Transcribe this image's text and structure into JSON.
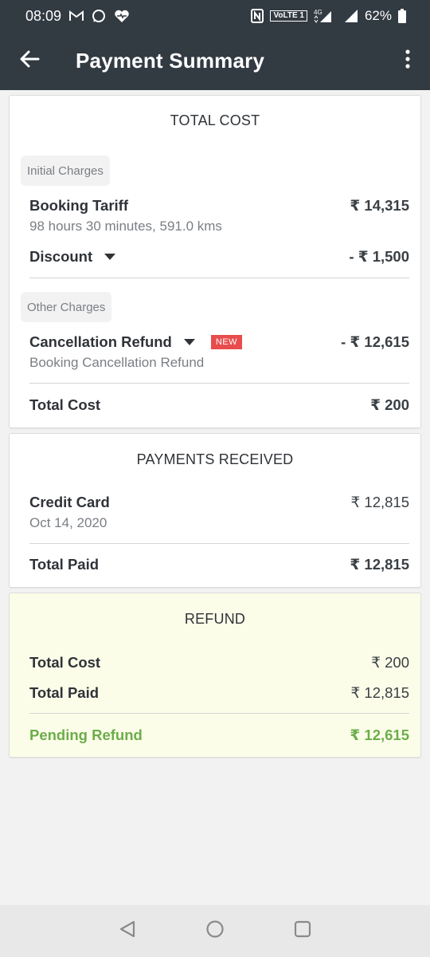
{
  "status_bar": {
    "time": "08:09",
    "network_label": "VoLTE 1",
    "network_type": "4G",
    "battery": "62%"
  },
  "app_bar": {
    "title": "Payment Summary"
  },
  "total_cost_card": {
    "title": "TOTAL COST",
    "initial_charges_label": "Initial Charges",
    "booking_tariff_label": "Booking Tariff",
    "booking_tariff_value": "₹ 14,315",
    "booking_tariff_detail": "98 hours 30 minutes, 591.0 kms",
    "discount_label": "Discount",
    "discount_value": "- ₹ 1,500",
    "other_charges_label": "Other Charges",
    "cancellation_label": "Cancellation Refund",
    "cancellation_badge": "NEW",
    "cancellation_value": "- ₹ 12,615",
    "cancellation_detail": "Booking Cancellation Refund",
    "total_label": "Total Cost",
    "total_value": "₹ 200"
  },
  "payments_card": {
    "title": "PAYMENTS RECEIVED",
    "method_label": "Credit Card",
    "method_value": "₹ 12,815",
    "method_date": "Oct 14, 2020",
    "total_label": "Total Paid",
    "total_value": "₹ 12,815"
  },
  "refund_card": {
    "title": "REFUND",
    "total_cost_label": "Total Cost",
    "total_cost_value": "₹ 200",
    "total_paid_label": "Total Paid",
    "total_paid_value": "₹ 12,815",
    "pending_label": "Pending Refund",
    "pending_value": "₹ 12,615"
  },
  "colors": {
    "app_bar": "#323a42",
    "refund_background": "#fcfde9",
    "pending_green": "#6bae4a",
    "new_badge": "#e84c4c"
  },
  "icons": {
    "back": "arrow-left",
    "menu": "vertical-dots",
    "nav_back": "triangle-back",
    "nav_home": "circle-home",
    "nav_recents": "square-recents"
  }
}
